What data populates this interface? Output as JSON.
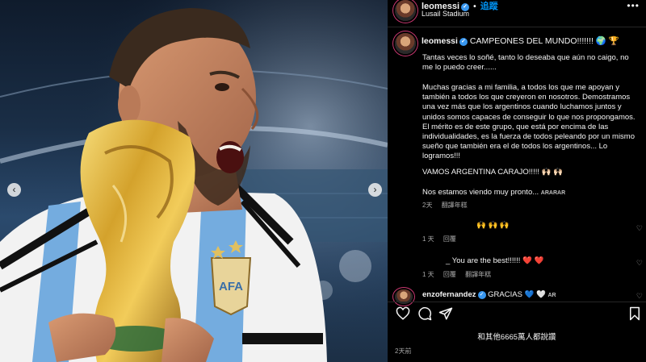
{
  "post": {
    "username": "leomessi",
    "follow_label": "追蹤",
    "location": "Lusail Stadium",
    "more_label": "•••",
    "date": "2天前"
  },
  "caption": {
    "username": "leomessi",
    "headline": "CAMPEONES DEL MUNDO!!!!!!! 🌍 🏆",
    "p1": "Tantas veces lo soñé, tanto lo deseaba que aún no caigo, no me lo puedo creer......",
    "p2": "Muchas gracias a mi familia, a todos los que me apoyan y también a todos los que creyeron en nosotros. Demostramos una vez más que los argentinos cuando luchamos juntos y unidos somos capaces de conseguir lo que nos propongamos. El mérito es de este grupo, que está por encima de las individualidades, es la fuerza de todos peleando por un mismo sueño que también era el de todos los argentinos... Lo logramos!!!",
    "p3": "VAMOS ARGENTINA CARAJO!!!!! 🙌🏻 🙌🏻",
    "p4_text": "Nos estamos viendo muy pronto...",
    "p4_tag": "ARARAR",
    "age": "2天",
    "translate": "翻譯年糕"
  },
  "comments": [
    {
      "text": "🙌 🙌 🙌",
      "age": "1 天",
      "reply": "回覆"
    },
    {
      "text": "_ You are the best!!!!!! ❤️ ❤️",
      "age": "1 天",
      "reply": "回覆",
      "translate": "翻譯年糕"
    },
    {
      "username": "enzofernandez",
      "text": "GRACIAS 💙 🤍",
      "tag": "AR"
    }
  ],
  "likes_text": "和其他6665萬人都說讚",
  "icons": {
    "prev": "‹",
    "next": "›",
    "heart_small": "♡"
  },
  "colors": {
    "accent": "#0095f6",
    "verified": "#3897f0",
    "background": "#000000"
  }
}
